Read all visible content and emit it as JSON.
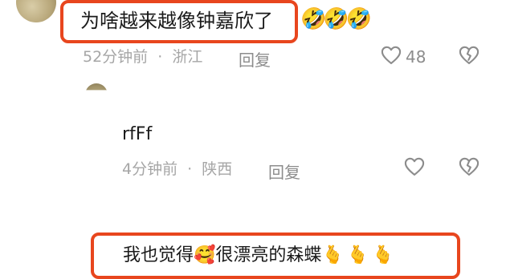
{
  "comments": [
    {
      "text": "为啥越来越像钟嘉欣了",
      "trailing_emoji": "🤣🤣🤣",
      "time": "52分钟前",
      "sep": "·",
      "location": "浙江",
      "reply_label": "回复",
      "like_count": "48",
      "highlighted": true
    },
    {
      "text": "rfFf",
      "time": "4分钟前",
      "sep": "·",
      "location": "陕西",
      "reply_label": "回复",
      "highlighted": false
    },
    {
      "text_before": "我也觉得",
      "mid_emoji": "🥰",
      "text_after": "很漂亮的森蝶",
      "trailing_emoji": "🫰🫰🫰",
      "highlighted": true
    }
  ],
  "icons": {
    "like": "heart-outline-icon",
    "dislike": "broken-heart-outline-icon"
  },
  "colors": {
    "highlight_border": "#e8461e",
    "meta_text": "#a6a6a6"
  }
}
